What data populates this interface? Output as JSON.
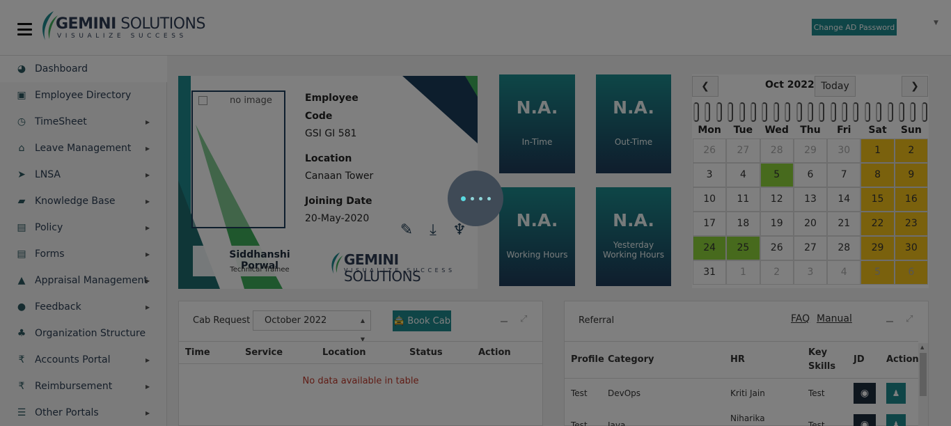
{
  "header": {
    "logo_main_bold": "GEMINI",
    "logo_main_rest": " SOLUTIONS",
    "logo_tagline": "VISUALIZE SUCCESS",
    "change_password_label": "Change AD Password"
  },
  "sidebar": {
    "items": [
      {
        "label": "Dashboard",
        "icon": "dashboard-icon",
        "glyph": "◕",
        "has_arrow": false
      },
      {
        "label": "Employee Directory",
        "icon": "directory-icon",
        "glyph": "▣",
        "has_arrow": false
      },
      {
        "label": "TimeSheet",
        "icon": "clock-icon",
        "glyph": "◷",
        "has_arrow": true
      },
      {
        "label": "Leave Management",
        "icon": "home-icon",
        "glyph": "⌂",
        "has_arrow": true
      },
      {
        "label": "LNSA",
        "icon": "paper-plane-icon",
        "glyph": "➤",
        "has_arrow": true
      },
      {
        "label": "Knowledge Base",
        "icon": "folder-open-icon",
        "glyph": "▰",
        "has_arrow": true
      },
      {
        "label": "Policy",
        "icon": "document-icon",
        "glyph": "▤",
        "has_arrow": true
      },
      {
        "label": "Forms",
        "icon": "form-icon",
        "glyph": "▤",
        "has_arrow": true
      },
      {
        "label": "Appraisal Management",
        "icon": "graduation-cap-icon",
        "glyph": "▲",
        "has_arrow": true
      },
      {
        "label": "Feedback",
        "icon": "comments-icon",
        "glyph": "●",
        "has_arrow": true
      },
      {
        "label": "Organization Structure",
        "icon": "sitemap-icon",
        "glyph": "♣",
        "has_arrow": false
      },
      {
        "label": "Accounts Portal",
        "icon": "rupee-icon",
        "glyph": "₹",
        "has_arrow": true
      },
      {
        "label": "Reimbursement",
        "icon": "rupee-icon",
        "glyph": "₹",
        "has_arrow": true
      },
      {
        "label": "Other Portals",
        "icon": "list-icon",
        "glyph": "☰",
        "has_arrow": true
      }
    ]
  },
  "profile": {
    "photo_alt": "no image",
    "code_label_line1": "Employee",
    "code_label_line2": "Code",
    "code_value": "GSI GI 581",
    "location_label": "Location",
    "location_value": "Canaan Tower",
    "joining_label": "Joining Date",
    "joining_value": "20-May-2020",
    "name": "Siddhanshi Porwal",
    "designation": "Technical Trainee",
    "logo_bold": "GEMINI",
    "logo_rest": " SOLUTIONS",
    "logo_tagline": "VISUALIZE SUCCESS"
  },
  "tiles": [
    {
      "value": "N.A.",
      "label_line1": "In-Time",
      "label_line2": ""
    },
    {
      "value": "N.A.",
      "label_line1": "Out-Time",
      "label_line2": ""
    },
    {
      "value": "N.A.",
      "label_line1": "Working Hours",
      "label_line2": ""
    },
    {
      "value": "N.A.",
      "label_line1": "Yesterday",
      "label_line2": "Working Hours"
    }
  ],
  "calendar": {
    "title": "Oct 2022",
    "prev": "❮",
    "next": "❯",
    "today_label": "Today",
    "weekdays": [
      "Mon",
      "Tue",
      "Wed",
      "Thu",
      "Fri",
      "Sat",
      "Sun"
    ],
    "weeks": [
      [
        {
          "d": "26",
          "t": "other"
        },
        {
          "d": "27",
          "t": "other"
        },
        {
          "d": "28",
          "t": "other"
        },
        {
          "d": "29",
          "t": "other"
        },
        {
          "d": "30",
          "t": "other"
        },
        {
          "d": "1",
          "t": "wk"
        },
        {
          "d": "2",
          "t": "wk"
        }
      ],
      [
        {
          "d": "3",
          "t": ""
        },
        {
          "d": "4",
          "t": ""
        },
        {
          "d": "5",
          "t": "gr"
        },
        {
          "d": "6",
          "t": ""
        },
        {
          "d": "7",
          "t": ""
        },
        {
          "d": "8",
          "t": "wk"
        },
        {
          "d": "9",
          "t": "wk"
        }
      ],
      [
        {
          "d": "10",
          "t": ""
        },
        {
          "d": "11",
          "t": ""
        },
        {
          "d": "12",
          "t": ""
        },
        {
          "d": "13",
          "t": ""
        },
        {
          "d": "14",
          "t": ""
        },
        {
          "d": "15",
          "t": "wk"
        },
        {
          "d": "16",
          "t": "wk"
        }
      ],
      [
        {
          "d": "17",
          "t": ""
        },
        {
          "d": "18",
          "t": ""
        },
        {
          "d": "19",
          "t": ""
        },
        {
          "d": "20",
          "t": ""
        },
        {
          "d": "21",
          "t": ""
        },
        {
          "d": "22",
          "t": "wk"
        },
        {
          "d": "23",
          "t": "wk"
        }
      ],
      [
        {
          "d": "24",
          "t": "gr"
        },
        {
          "d": "25",
          "t": "gr"
        },
        {
          "d": "26",
          "t": ""
        },
        {
          "d": "27",
          "t": ""
        },
        {
          "d": "28",
          "t": ""
        },
        {
          "d": "29",
          "t": "wk"
        },
        {
          "d": "30",
          "t": "wk"
        }
      ],
      [
        {
          "d": "31",
          "t": ""
        },
        {
          "d": "1",
          "t": "other"
        },
        {
          "d": "2",
          "t": "other"
        },
        {
          "d": "3",
          "t": "other"
        },
        {
          "d": "4",
          "t": "other"
        },
        {
          "d": "5",
          "t": "wk other"
        },
        {
          "d": "6",
          "t": "wk other"
        }
      ]
    ]
  },
  "cab": {
    "title": "Cab Request",
    "month_value": "October 2022",
    "book_label": "Book Cab",
    "columns": [
      "Time",
      "Service",
      "Location",
      "Status",
      "Action"
    ],
    "empty_text": "No data available in table"
  },
  "referral": {
    "title": "Referral",
    "faq_label": "FAQ",
    "manual_label": "Manual",
    "columns": [
      "Profile",
      "Category",
      "HR",
      "Key Skills",
      "JD",
      "Action"
    ],
    "rows": [
      {
        "profile": "Test",
        "category": "DevOps",
        "hr": "Kriti Jain",
        "skills": "Test"
      },
      {
        "profile": "Test",
        "category": "Java",
        "hr": "Niharika",
        "skills": "Test"
      }
    ]
  },
  "colors": {
    "accent": "#1f8a8f",
    "navy": "#1e3b5a",
    "weekend": "#f5c21b",
    "present": "#8fd43b"
  }
}
